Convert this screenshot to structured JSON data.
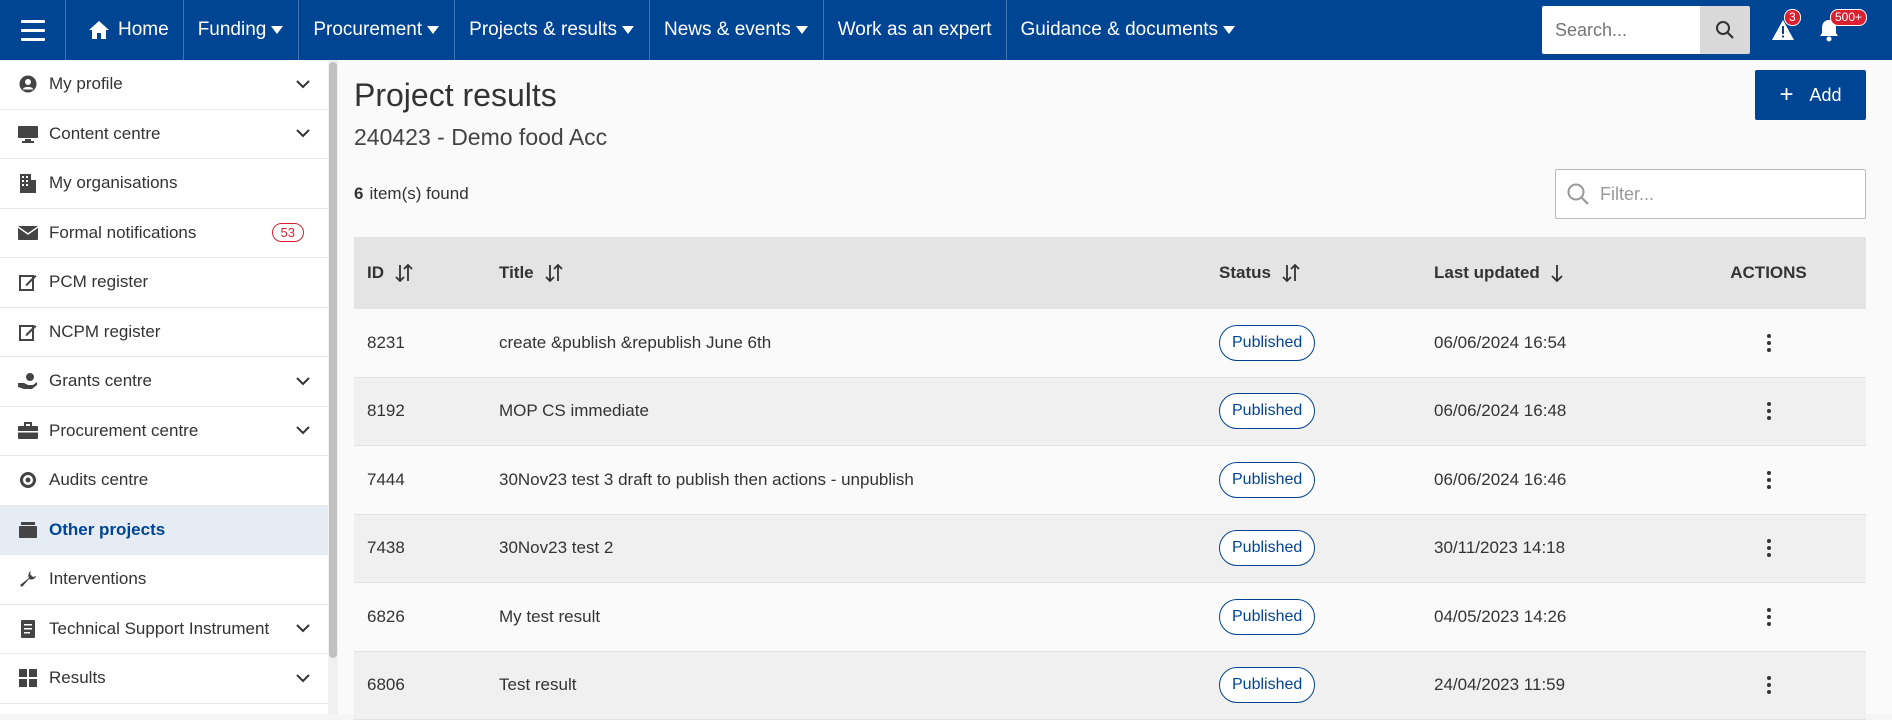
{
  "topnav": {
    "home": "Home",
    "items": [
      "Funding",
      "Procurement",
      "Projects & results",
      "News & events",
      "Work as an expert",
      "Guidance & documents"
    ],
    "search_placeholder": "Search...",
    "alerts_count": "3",
    "notifications_count": "500+"
  },
  "sidebar": {
    "items": [
      {
        "label": "My profile",
        "icon": "user-circle-icon",
        "expandable": true
      },
      {
        "label": "Content centre",
        "icon": "monitor-icon",
        "expandable": true
      },
      {
        "label": "My organisations",
        "icon": "building-icon",
        "expandable": false
      },
      {
        "label": "Formal notifications",
        "icon": "envelope-icon",
        "expandable": false,
        "badge": "53"
      },
      {
        "label": "PCM register",
        "icon": "edit-icon",
        "expandable": false
      },
      {
        "label": "NCPM register",
        "icon": "edit-icon",
        "expandable": false
      },
      {
        "label": "Grants centre",
        "icon": "hand-coins-icon",
        "expandable": true
      },
      {
        "label": "Procurement centre",
        "icon": "briefcase-icon",
        "expandable": true
      },
      {
        "label": "Audits centre",
        "icon": "target-icon",
        "expandable": false
      },
      {
        "label": "Other projects",
        "icon": "folder-stack-icon",
        "expandable": false,
        "active": true
      },
      {
        "label": "Interventions",
        "icon": "wrench-icon",
        "expandable": false
      },
      {
        "label": "Technical Support Instrument",
        "icon": "document-icon",
        "expandable": true
      },
      {
        "label": "Results",
        "icon": "grid-icon",
        "expandable": true
      }
    ]
  },
  "main": {
    "title": "Project results",
    "subtitle": "240423 - Demo food Acc",
    "add_label": "Add",
    "found_count": "6",
    "found_text": "item(s) found",
    "filter_placeholder": "Filter...",
    "columns": {
      "id": "ID",
      "title": "Title",
      "status": "Status",
      "updated": "Last updated",
      "actions": "ACTIONS"
    },
    "rows": [
      {
        "id": "8231",
        "title": "create &publish &republish June 6th",
        "status": "Published",
        "updated": "06/06/2024 16:54"
      },
      {
        "id": "8192",
        "title": "MOP CS immediate",
        "status": "Published",
        "updated": "06/06/2024 16:48"
      },
      {
        "id": "7444",
        "title": "30Nov23 test 3 draft to publish then actions - unpublish",
        "status": "Published",
        "updated": "06/06/2024 16:46"
      },
      {
        "id": "7438",
        "title": "30Nov23 test 2",
        "status": "Published",
        "updated": "30/11/2023 14:18"
      },
      {
        "id": "6826",
        "title": "My test result",
        "status": "Published",
        "updated": "04/05/2023 14:26"
      },
      {
        "id": "6806",
        "title": "Test result",
        "status": "Published",
        "updated": "24/04/2023 11:59"
      }
    ]
  },
  "colors": {
    "brand": "#004494",
    "badge_red": "#da2131"
  }
}
